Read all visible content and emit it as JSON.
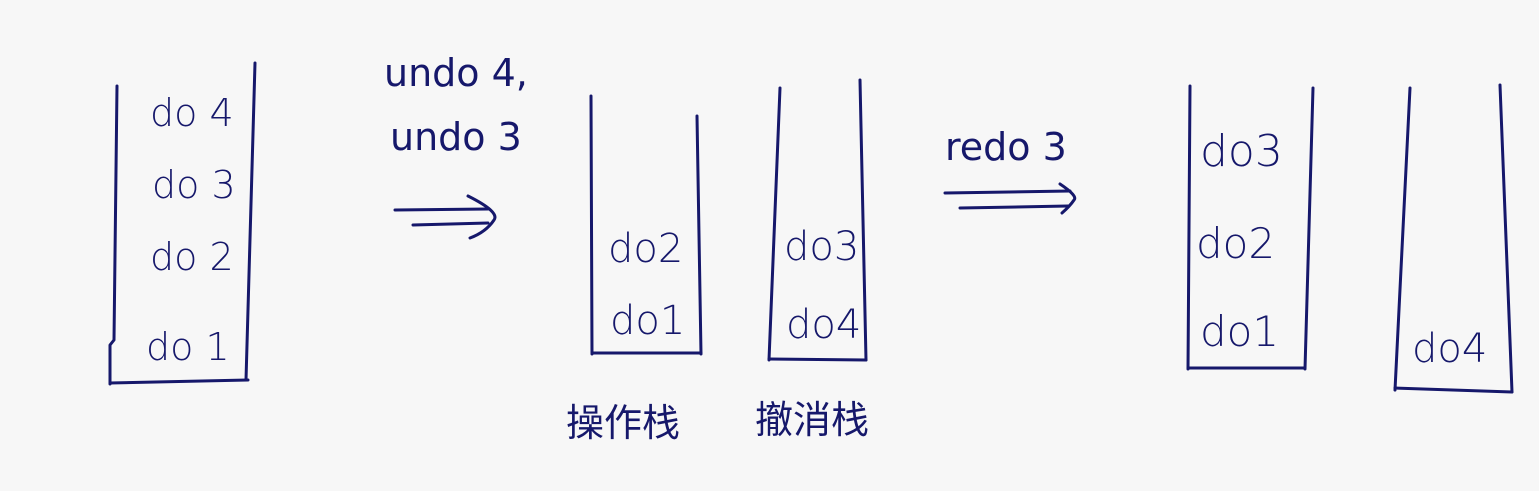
{
  "colors": {
    "ink": "#16186b",
    "background": "#f7f7f7"
  },
  "stacks": [
    {
      "items": [
        "do 4",
        "do 3",
        "do 2",
        "do 1"
      ]
    },
    {
      "items": [
        "do2",
        "do1"
      ],
      "label": "操作栈"
    },
    {
      "items": [
        "do3",
        "do4"
      ],
      "label": "撤消栈"
    },
    {
      "items": [
        "do3",
        "do2",
        "do1"
      ]
    },
    {
      "items": [
        "do4"
      ]
    }
  ],
  "transitions": [
    {
      "lines": [
        "undo 4,",
        "undo 3"
      ]
    },
    {
      "lines": [
        "redo 3"
      ]
    }
  ]
}
